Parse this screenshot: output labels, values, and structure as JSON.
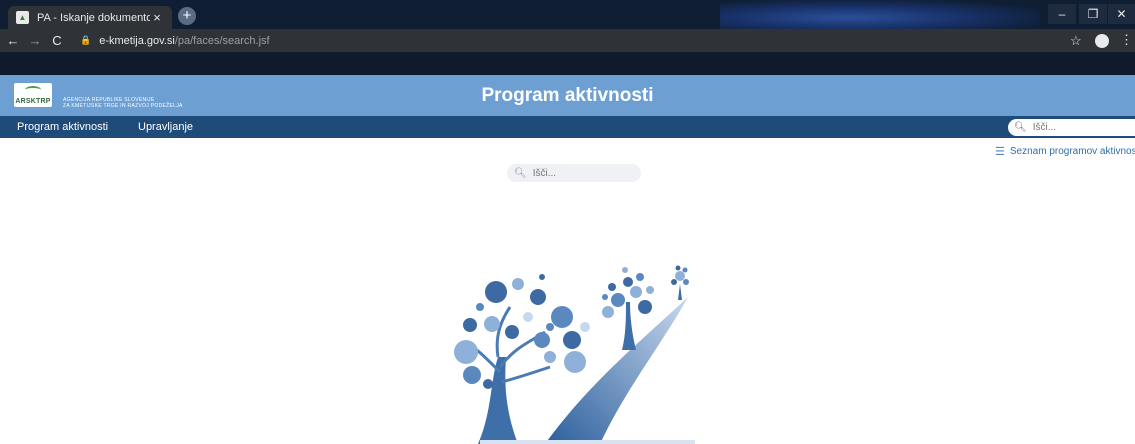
{
  "browser": {
    "tab_title": "PA - Iskanje dokumentov",
    "tab_close": "×",
    "new_tab": "+",
    "url_host": "e-kmetija.gov.si",
    "url_path": "/pa/faces/search.jsf",
    "win_min": "–",
    "win_max": "❐",
    "win_close": "✕"
  },
  "header": {
    "logo_text": "ARSKTRP",
    "agency_line1": "AGENCIJA REPUBLIKE SLOVENIJE",
    "agency_line2": "ZA KMETIJSKE TRGE IN RAZVOJ PODEŽELJA",
    "title": "Program aktivnosti"
  },
  "nav": {
    "items": [
      {
        "label": "Program aktivnosti"
      },
      {
        "label": "Upravljanje"
      }
    ],
    "search_placeholder": "Išči..."
  },
  "content": {
    "list_link": "Seznam programov aktivnosti",
    "search_placeholder": "Išči..."
  },
  "colors": {
    "header_bg": "#6e9fd2",
    "nav_bg": "#1f4b7a",
    "link": "#2f6ea8"
  }
}
